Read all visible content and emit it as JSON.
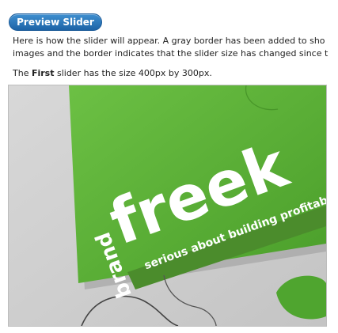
{
  "preview_button": {
    "label": "Preview Slider"
  },
  "description": {
    "line1": "Here is how the slider will appear. A gray border has been added to sho",
    "line2": "images and the border indicates that the slider size has changed since t"
  },
  "size_note": {
    "prefix": "The ",
    "bold": "First",
    "suffix": " slider has the size 400px by 300px."
  },
  "slider_image": {
    "brand_text": "brand",
    "logo_text": "freek",
    "tagline": "serious about building profitable",
    "accent_color": "#5ab33a"
  }
}
